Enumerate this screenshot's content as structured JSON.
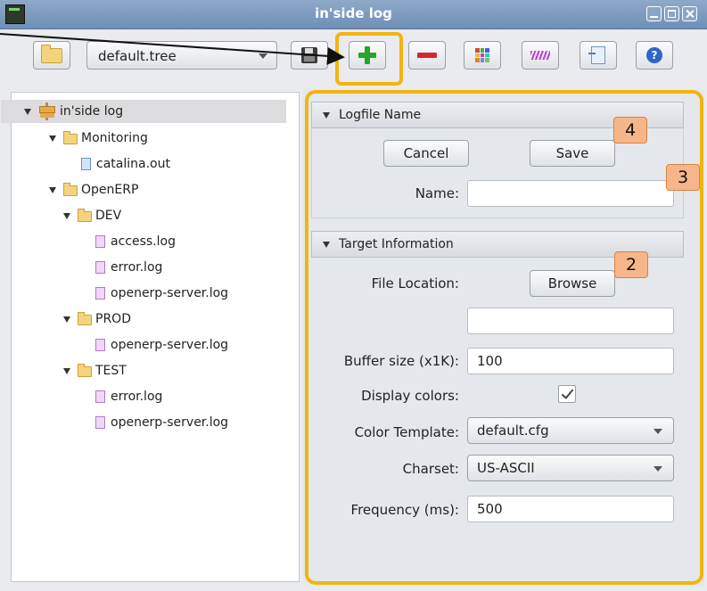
{
  "window": {
    "title": "in'side log"
  },
  "toolbar": {
    "tree_file": "default.tree"
  },
  "tree": {
    "items": [
      {
        "label": "in'side log"
      },
      {
        "label": "Monitoring"
      },
      {
        "label": "catalina.out"
      },
      {
        "label": "OpenERP"
      },
      {
        "label": "DEV"
      },
      {
        "label": "access.log"
      },
      {
        "label": "error.log"
      },
      {
        "label": "openerp-server.log"
      },
      {
        "label": "PROD"
      },
      {
        "label": "openerp-server.log"
      },
      {
        "label": "TEST"
      },
      {
        "label": "error.log"
      },
      {
        "label": "openerp-server.log"
      }
    ]
  },
  "logfile": {
    "header": "Logfile Name",
    "cancel_label": "Cancel",
    "save_label": "Save",
    "name_label": "Name:",
    "name_value": ""
  },
  "target": {
    "header": "Target Information",
    "file_location_label": "File Location:",
    "browse_label": "Browse",
    "file_location_value": "",
    "buffer_label": "Buffer size (x1K):",
    "buffer_value": "100",
    "display_colors_label": "Display colors:",
    "color_template_label": "Color Template:",
    "color_template_value": "default.cfg",
    "charset_label": "Charset:",
    "charset_value": "US-ASCII",
    "frequency_label": "Frequency (ms):",
    "frequency_value": "500"
  },
  "annotations": {
    "badge_4": "4",
    "badge_3": "3",
    "badge_2": "2"
  },
  "colors": {
    "highlight": "#f2b412",
    "badge_fill": "#f7b68a",
    "add_green": "#26a526",
    "remove_red": "#d8262b"
  }
}
